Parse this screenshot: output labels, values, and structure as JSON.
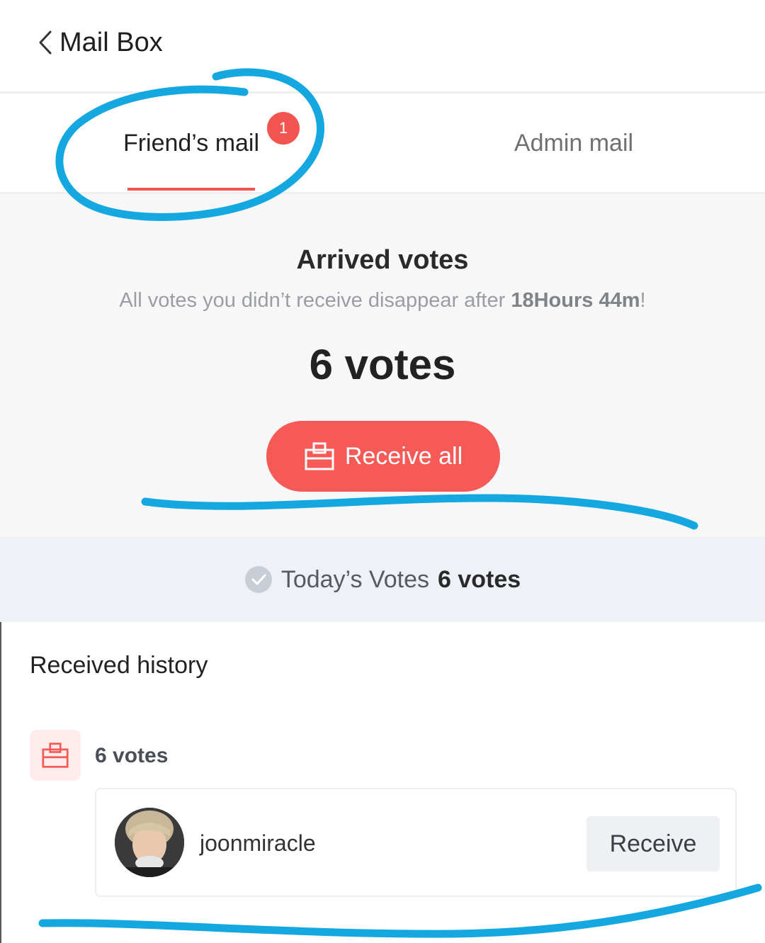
{
  "header": {
    "title": "Mail Box"
  },
  "tabs": {
    "friend": {
      "label": "Friend’s mail",
      "badge": "1"
    },
    "admin": {
      "label": "Admin mail"
    }
  },
  "arrived": {
    "title": "Arrived votes",
    "note_prefix": "All votes you didn’t receive disappear after ",
    "note_time": "18Hours 44m",
    "note_suffix": "!",
    "count": "6 votes",
    "receive_all_label": "Receive all"
  },
  "today": {
    "label": "Today’s Votes",
    "value": "6 votes"
  },
  "history": {
    "title": "Received history",
    "group_count": "6 votes",
    "items": [
      {
        "username": "joonmiracle",
        "button_label": "Receive"
      }
    ]
  },
  "colors": {
    "accent": "#f55a56",
    "badge": "#f2554f",
    "annotation": "#15a8e0"
  }
}
